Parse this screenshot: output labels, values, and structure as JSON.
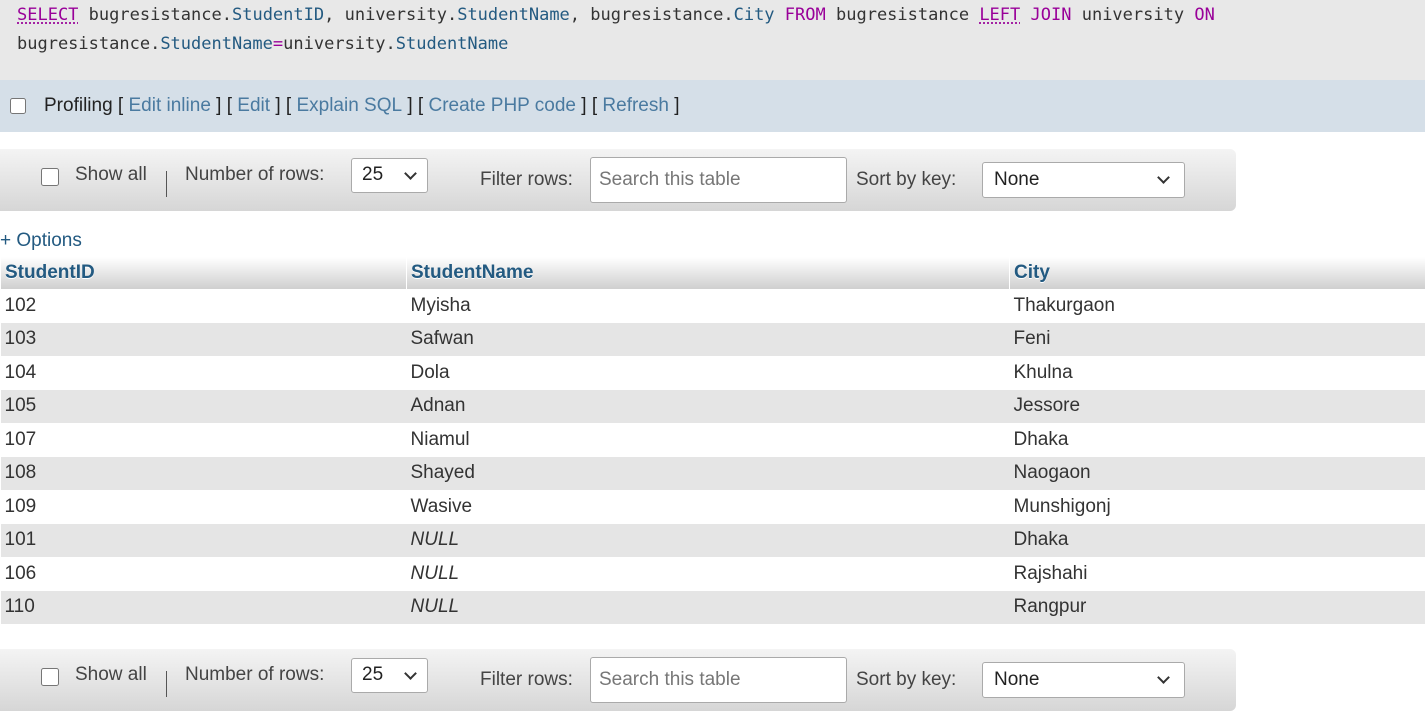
{
  "sql": {
    "select": "SELECT",
    "t1": "bugresistance",
    "c1": "StudentID",
    "t2": "university",
    "c2": "StudentName",
    "t3": "bugresistance",
    "c3": "City",
    "from": "FROM",
    "t4": "bugresistance",
    "left": "LEFT",
    "join": "JOIN",
    "t5": "university",
    "on": "ON",
    "t6": "bugresistance",
    "c6": "StudentName",
    "eq": "=",
    "t7": "university",
    "c7": "StudentName"
  },
  "profiling": {
    "label": "Profiling",
    "links": [
      "Edit inline",
      "Edit",
      "Explain SQL",
      "Create PHP code",
      "Refresh"
    ]
  },
  "nav": {
    "show_all": "Show all",
    "rows_label": "Number of rows:",
    "rows_value": "25",
    "filter_label": "Filter rows:",
    "filter_placeholder": "Search this table",
    "sort_label": "Sort by key:",
    "sort_value": "None"
  },
  "options_link": "+ Options",
  "table": {
    "columns": [
      "StudentID",
      "StudentName",
      "City"
    ],
    "rows": [
      [
        "102",
        "Myisha",
        "Thakurgaon"
      ],
      [
        "103",
        "Safwan",
        "Feni"
      ],
      [
        "104",
        "Dola",
        "Khulna"
      ],
      [
        "105",
        "Adnan",
        "Jessore"
      ],
      [
        "107",
        "Niamul",
        "Dhaka"
      ],
      [
        "108",
        "Shayed",
        "Naogaon"
      ],
      [
        "109",
        "Wasive",
        "Munshigonj"
      ],
      [
        "101",
        "NULL",
        "Dhaka"
      ],
      [
        "106",
        "NULL",
        "Rajshahi"
      ],
      [
        "110",
        "NULL",
        "Rangpur"
      ]
    ]
  }
}
